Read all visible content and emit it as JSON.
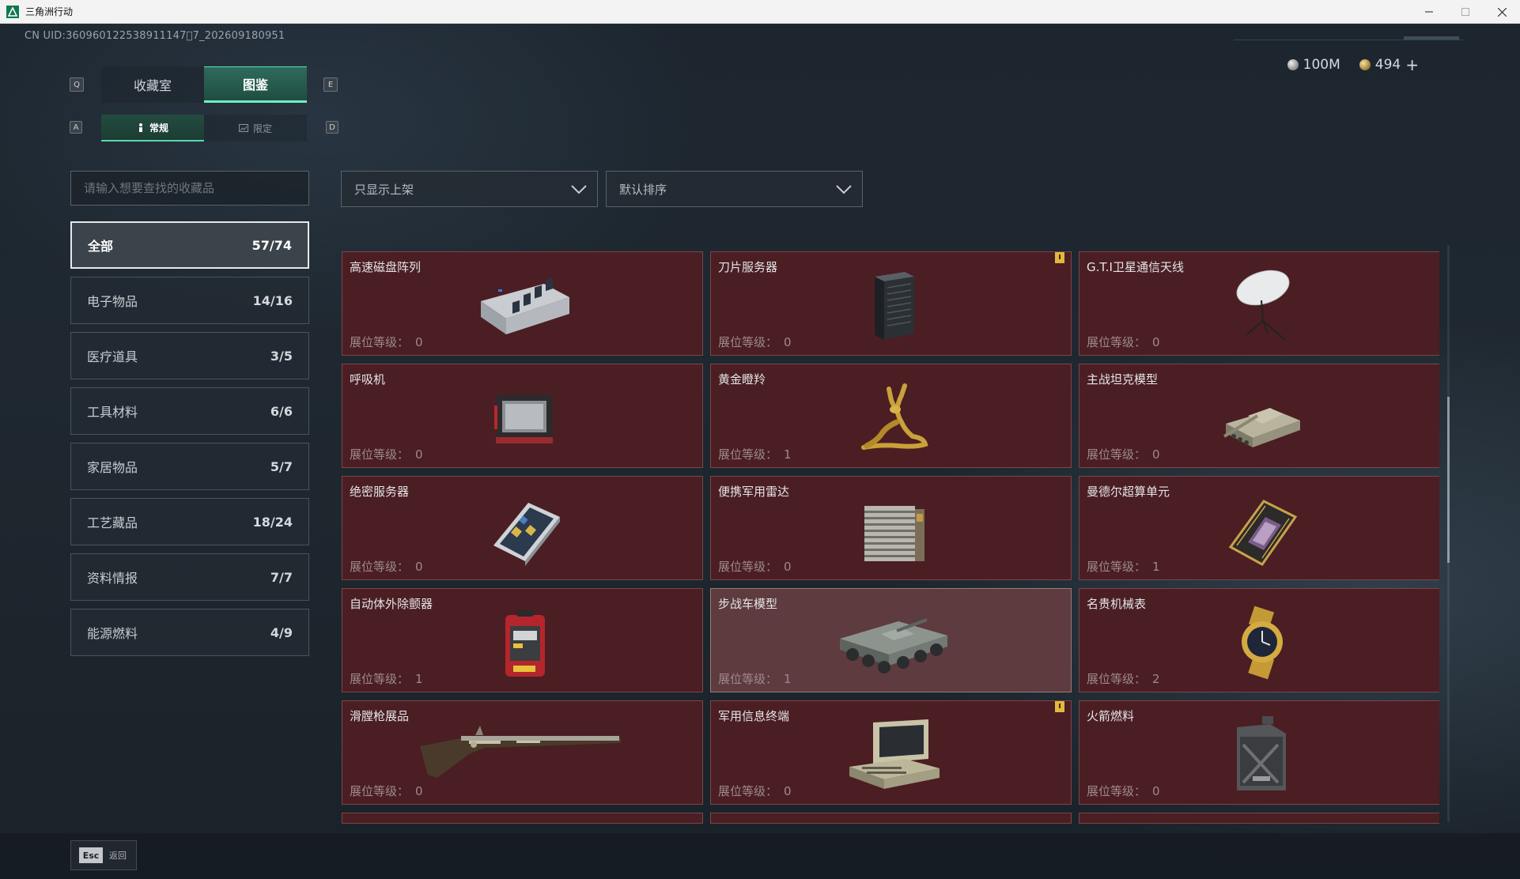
{
  "window": {
    "title": "三角洲行动"
  },
  "header": {
    "uid": "CN UID:360960122538911147\u00007_202609180951",
    "currency": [
      {
        "icon": "silver-coin-icon",
        "value": "100M"
      },
      {
        "icon": "gold-coin-icon",
        "value": "494"
      }
    ],
    "plus": "+"
  },
  "tabs": {
    "key_left": "Q",
    "key_right": "E",
    "items": [
      {
        "label": "收藏室",
        "active": false
      },
      {
        "label": "图鉴",
        "active": true
      }
    ]
  },
  "subtabs": {
    "key_left": "A",
    "key_right": "D",
    "items": [
      {
        "label": "常规",
        "icon": "figure-icon",
        "active": true
      },
      {
        "label": "限定",
        "icon": "picture-icon",
        "active": false
      }
    ]
  },
  "search": {
    "placeholder": "请输入想要查找的收藏品"
  },
  "categories": [
    {
      "label": "全部",
      "count": "57/74",
      "active": true
    },
    {
      "label": "电子物品",
      "count": "14/16"
    },
    {
      "label": "医疗道具",
      "count": "3/5"
    },
    {
      "label": "工具材料",
      "count": "6/6"
    },
    {
      "label": "家居物品",
      "count": "5/7"
    },
    {
      "label": "工艺藏品",
      "count": "18/24"
    },
    {
      "label": "资料情报",
      "count": "7/7"
    },
    {
      "label": "能源燃料",
      "count": "4/9"
    }
  ],
  "filters": {
    "shelf": "只显示上架",
    "sort": "默认排序"
  },
  "level_label": "展位等级：",
  "items": [
    {
      "name": "高速磁盘阵列",
      "level": "0",
      "icon": "disk-array-icon"
    },
    {
      "name": "刀片服务器",
      "level": "0",
      "icon": "blade-server-icon",
      "flag": true
    },
    {
      "name": "G.T.I卫星通信天线",
      "level": "0",
      "icon": "satellite-antenna-icon"
    },
    {
      "name": "呼吸机",
      "level": "0",
      "icon": "ventilator-icon"
    },
    {
      "name": "黄金瞪羚",
      "level": "1",
      "icon": "golden-gazelle-icon"
    },
    {
      "name": "主战坦克模型",
      "level": "0",
      "icon": "tank-model-icon"
    },
    {
      "name": "绝密服务器",
      "level": "0",
      "icon": "secret-server-icon"
    },
    {
      "name": "便携军用雷达",
      "level": "0",
      "icon": "portable-radar-icon"
    },
    {
      "name": "曼德尔超算单元",
      "level": "1",
      "icon": "supercomputer-unit-icon"
    },
    {
      "name": "自动体外除颤器",
      "level": "1",
      "icon": "defibrillator-icon"
    },
    {
      "name": "步战车模型",
      "level": "1",
      "icon": "ifv-model-icon",
      "hover": true
    },
    {
      "name": "名贵机械表",
      "level": "2",
      "icon": "luxury-watch-icon"
    },
    {
      "name": "滑膛枪展品",
      "level": "0",
      "icon": "musket-icon"
    },
    {
      "name": "军用信息终端",
      "level": "0",
      "icon": "military-terminal-icon",
      "flag": true
    },
    {
      "name": "火箭燃料",
      "level": "0",
      "icon": "rocket-fuel-icon"
    }
  ],
  "footer": {
    "esc_key": "Esc",
    "back_label": "返回"
  }
}
